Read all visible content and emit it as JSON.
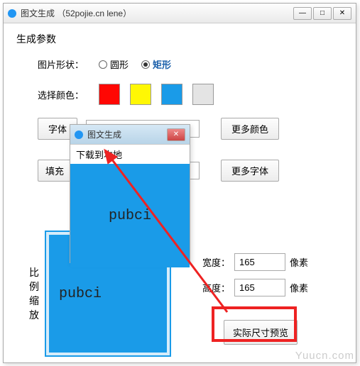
{
  "main_window": {
    "title": "图文生成 （52pojie.cn lene）",
    "controls": {
      "min": "—",
      "max": "□",
      "close": "✕"
    }
  },
  "section_title": "生成参数",
  "shape": {
    "label": "图片形状：",
    "opt_circle": "圆形",
    "opt_rect": "矩形"
  },
  "color": {
    "label": "选择颜色：",
    "swatches": [
      "#ff0703",
      "#fff704",
      "#1a9be8",
      "#e4e4e4"
    ]
  },
  "buttons": {
    "font": "字体",
    "more_color": "更多颜色",
    "fill": "填充",
    "more_font": "更多字体",
    "actual_preview": "实际尺寸预览"
  },
  "preview": {
    "label_lines": [
      "比",
      "例",
      "缩",
      "放"
    ],
    "text": "pubci"
  },
  "dims": {
    "width_label": "宽度：",
    "height_label": "高度：",
    "width_value": "165",
    "height_value": "165",
    "unit": "像素"
  },
  "popup": {
    "title": "图文生成",
    "menu_item": "下载到本地",
    "body_text": "pubci",
    "close": "✕"
  },
  "watermark": "Yuucn.com"
}
